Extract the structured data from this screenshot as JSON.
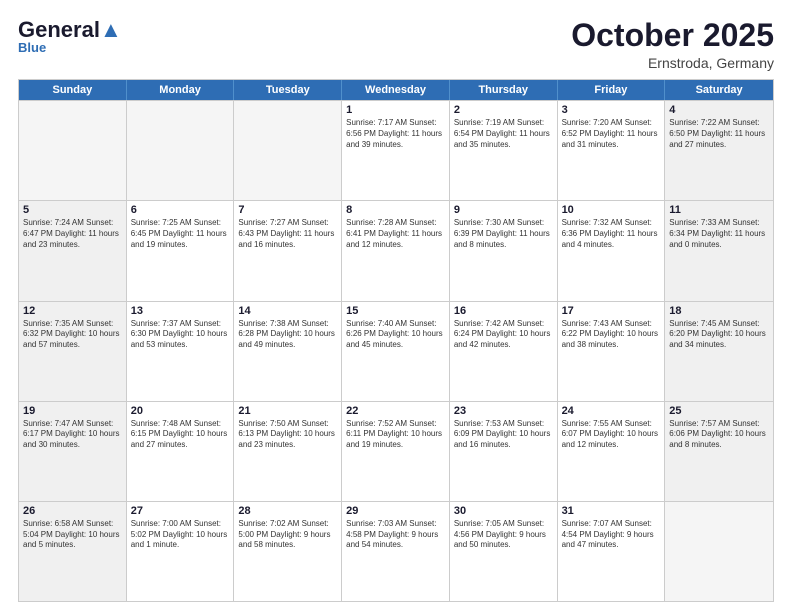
{
  "header": {
    "logo_general": "General",
    "logo_blue": "Blue",
    "month": "October 2025",
    "location": "Ernstroda, Germany"
  },
  "weekdays": [
    "Sunday",
    "Monday",
    "Tuesday",
    "Wednesday",
    "Thursday",
    "Friday",
    "Saturday"
  ],
  "rows": [
    [
      {
        "day": "",
        "info": "",
        "empty": true
      },
      {
        "day": "",
        "info": "",
        "empty": true
      },
      {
        "day": "",
        "info": "",
        "empty": true
      },
      {
        "day": "1",
        "info": "Sunrise: 7:17 AM\nSunset: 6:56 PM\nDaylight: 11 hours\nand 39 minutes.",
        "empty": false
      },
      {
        "day": "2",
        "info": "Sunrise: 7:19 AM\nSunset: 6:54 PM\nDaylight: 11 hours\nand 35 minutes.",
        "empty": false
      },
      {
        "day": "3",
        "info": "Sunrise: 7:20 AM\nSunset: 6:52 PM\nDaylight: 11 hours\nand 31 minutes.",
        "empty": false
      },
      {
        "day": "4",
        "info": "Sunrise: 7:22 AM\nSunset: 6:50 PM\nDaylight: 11 hours\nand 27 minutes.",
        "empty": false,
        "shaded": true
      }
    ],
    [
      {
        "day": "5",
        "info": "Sunrise: 7:24 AM\nSunset: 6:47 PM\nDaylight: 11 hours\nand 23 minutes.",
        "empty": false,
        "shaded": true
      },
      {
        "day": "6",
        "info": "Sunrise: 7:25 AM\nSunset: 6:45 PM\nDaylight: 11 hours\nand 19 minutes.",
        "empty": false
      },
      {
        "day": "7",
        "info": "Sunrise: 7:27 AM\nSunset: 6:43 PM\nDaylight: 11 hours\nand 16 minutes.",
        "empty": false
      },
      {
        "day": "8",
        "info": "Sunrise: 7:28 AM\nSunset: 6:41 PM\nDaylight: 11 hours\nand 12 minutes.",
        "empty": false
      },
      {
        "day": "9",
        "info": "Sunrise: 7:30 AM\nSunset: 6:39 PM\nDaylight: 11 hours\nand 8 minutes.",
        "empty": false
      },
      {
        "day": "10",
        "info": "Sunrise: 7:32 AM\nSunset: 6:36 PM\nDaylight: 11 hours\nand 4 minutes.",
        "empty": false
      },
      {
        "day": "11",
        "info": "Sunrise: 7:33 AM\nSunset: 6:34 PM\nDaylight: 11 hours\nand 0 minutes.",
        "empty": false,
        "shaded": true
      }
    ],
    [
      {
        "day": "12",
        "info": "Sunrise: 7:35 AM\nSunset: 6:32 PM\nDaylight: 10 hours\nand 57 minutes.",
        "empty": false,
        "shaded": true
      },
      {
        "day": "13",
        "info": "Sunrise: 7:37 AM\nSunset: 6:30 PM\nDaylight: 10 hours\nand 53 minutes.",
        "empty": false
      },
      {
        "day": "14",
        "info": "Sunrise: 7:38 AM\nSunset: 6:28 PM\nDaylight: 10 hours\nand 49 minutes.",
        "empty": false
      },
      {
        "day": "15",
        "info": "Sunrise: 7:40 AM\nSunset: 6:26 PM\nDaylight: 10 hours\nand 45 minutes.",
        "empty": false
      },
      {
        "day": "16",
        "info": "Sunrise: 7:42 AM\nSunset: 6:24 PM\nDaylight: 10 hours\nand 42 minutes.",
        "empty": false
      },
      {
        "day": "17",
        "info": "Sunrise: 7:43 AM\nSunset: 6:22 PM\nDaylight: 10 hours\nand 38 minutes.",
        "empty": false
      },
      {
        "day": "18",
        "info": "Sunrise: 7:45 AM\nSunset: 6:20 PM\nDaylight: 10 hours\nand 34 minutes.",
        "empty": false,
        "shaded": true
      }
    ],
    [
      {
        "day": "19",
        "info": "Sunrise: 7:47 AM\nSunset: 6:17 PM\nDaylight: 10 hours\nand 30 minutes.",
        "empty": false,
        "shaded": true
      },
      {
        "day": "20",
        "info": "Sunrise: 7:48 AM\nSunset: 6:15 PM\nDaylight: 10 hours\nand 27 minutes.",
        "empty": false
      },
      {
        "day": "21",
        "info": "Sunrise: 7:50 AM\nSunset: 6:13 PM\nDaylight: 10 hours\nand 23 minutes.",
        "empty": false
      },
      {
        "day": "22",
        "info": "Sunrise: 7:52 AM\nSunset: 6:11 PM\nDaylight: 10 hours\nand 19 minutes.",
        "empty": false
      },
      {
        "day": "23",
        "info": "Sunrise: 7:53 AM\nSunset: 6:09 PM\nDaylight: 10 hours\nand 16 minutes.",
        "empty": false
      },
      {
        "day": "24",
        "info": "Sunrise: 7:55 AM\nSunset: 6:07 PM\nDaylight: 10 hours\nand 12 minutes.",
        "empty": false
      },
      {
        "day": "25",
        "info": "Sunrise: 7:57 AM\nSunset: 6:06 PM\nDaylight: 10 hours\nand 8 minutes.",
        "empty": false,
        "shaded": true
      }
    ],
    [
      {
        "day": "26",
        "info": "Sunrise: 6:58 AM\nSunset: 5:04 PM\nDaylight: 10 hours\nand 5 minutes.",
        "empty": false,
        "shaded": true
      },
      {
        "day": "27",
        "info": "Sunrise: 7:00 AM\nSunset: 5:02 PM\nDaylight: 10 hours\nand 1 minute.",
        "empty": false
      },
      {
        "day": "28",
        "info": "Sunrise: 7:02 AM\nSunset: 5:00 PM\nDaylight: 9 hours\nand 58 minutes.",
        "empty": false
      },
      {
        "day": "29",
        "info": "Sunrise: 7:03 AM\nSunset: 4:58 PM\nDaylight: 9 hours\nand 54 minutes.",
        "empty": false
      },
      {
        "day": "30",
        "info": "Sunrise: 7:05 AM\nSunset: 4:56 PM\nDaylight: 9 hours\nand 50 minutes.",
        "empty": false
      },
      {
        "day": "31",
        "info": "Sunrise: 7:07 AM\nSunset: 4:54 PM\nDaylight: 9 hours\nand 47 minutes.",
        "empty": false
      },
      {
        "day": "",
        "info": "",
        "empty": true
      }
    ]
  ]
}
